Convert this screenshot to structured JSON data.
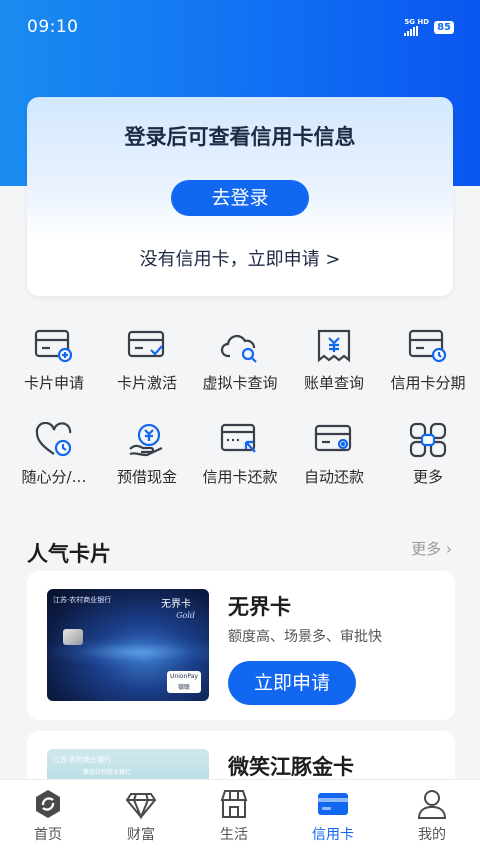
{
  "status": {
    "time": "09:10",
    "network": "5G HD",
    "battery": "85"
  },
  "login": {
    "title": "登录后可查看信用卡信息",
    "button": "去登录",
    "apply_link": "没有信用卡，立即申请 >"
  },
  "grid": [
    {
      "label": "卡片申请",
      "icon": "card-apply-icon"
    },
    {
      "label": "卡片激活",
      "icon": "card-activate-icon"
    },
    {
      "label": "虚拟卡查询",
      "icon": "cloud-search-icon"
    },
    {
      "label": "账单查询",
      "icon": "bill-icon"
    },
    {
      "label": "信用卡分期",
      "icon": "card-installment-icon"
    },
    {
      "label": "随心分/…",
      "icon": "heart-clock-icon"
    },
    {
      "label": "预借现金",
      "icon": "cash-hand-icon"
    },
    {
      "label": "信用卡还款",
      "icon": "card-repay-icon"
    },
    {
      "label": "自动还款",
      "icon": "card-auto-icon"
    },
    {
      "label": "更多",
      "icon": "more-grid-icon"
    }
  ],
  "section": {
    "title": "人气卡片",
    "more": "更多 ›"
  },
  "cards": [
    {
      "name": "无界卡",
      "desc": "额度高、场景多、审批快",
      "apply": "立即申请",
      "bank": "江苏·农村商业银行",
      "card_title": "无界卡",
      "card_sub": "Gold",
      "unionpay": "UnionPay 银联"
    },
    {
      "name": "微笑江豚金卡",
      "bank": "江苏·农村商业银行",
      "bank_sub": "紫金农村商业银行"
    }
  ],
  "nav": [
    {
      "label": "首页",
      "icon": "home-icon",
      "active": false
    },
    {
      "label": "财富",
      "icon": "wealth-diamond-icon",
      "active": false
    },
    {
      "label": "生活",
      "icon": "life-shop-icon",
      "active": false
    },
    {
      "label": "信用卡",
      "icon": "credit-card-icon",
      "active": true
    },
    {
      "label": "我的",
      "icon": "profile-icon",
      "active": false
    }
  ],
  "colors": {
    "primary": "#1167f0",
    "icon_stroke": "#3a3f4a",
    "icon_accent": "#1167f0"
  }
}
